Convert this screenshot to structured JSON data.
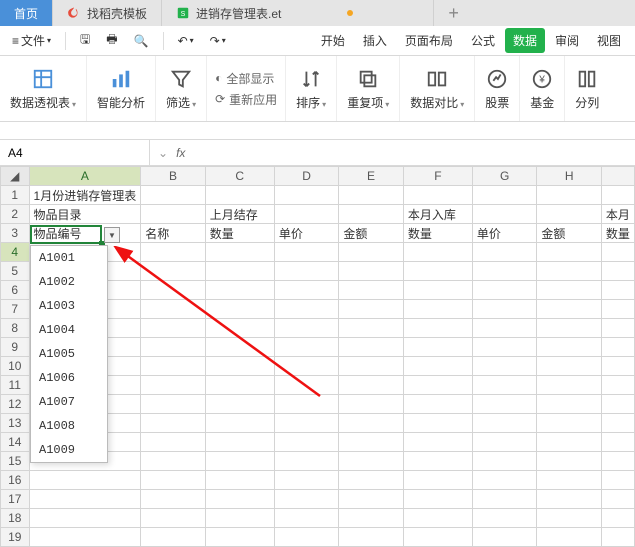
{
  "doc_tabs": {
    "home": "首页",
    "t1": "找稻壳模板",
    "t2": "进销存管理表.et",
    "add": "+"
  },
  "menu": {
    "file": "文件",
    "tabs": [
      "开始",
      "插入",
      "页面布局",
      "公式",
      "数据",
      "审阅",
      "视图"
    ],
    "active_tab": "数据"
  },
  "ribbon": {
    "pivot": "数据透视表",
    "smart": "智能分析",
    "filter": "筛选",
    "showall": "全部显示",
    "reapply": "重新应用",
    "sort": "排序",
    "dup": "重复项",
    "compare": "数据对比",
    "stock": "股票",
    "fund": "基金",
    "split": "分列"
  },
  "namebox": {
    "value": "A4"
  },
  "fx": {
    "label": "fx"
  },
  "cols": [
    "A",
    "B",
    "C",
    "D",
    "E",
    "F",
    "G",
    "H"
  ],
  "rows_count": 19,
  "cells": {
    "A1": "1月份进销存管理表",
    "A2": "物品目录",
    "C2": "上月结存",
    "F2": "本月入库",
    "I2": "本月",
    "A3": "物品编号",
    "B3": "名称",
    "C3": "数量",
    "D3": "单价",
    "E3": "金额",
    "F3": "数量",
    "G3": "单价",
    "H3": "金额",
    "I3": "数量"
  },
  "dropdown_options": [
    "A1001",
    "A1002",
    "A1003",
    "A1004",
    "A1005",
    "A1006",
    "A1007",
    "A1008",
    "A1009"
  ],
  "selected_cell": "A4"
}
